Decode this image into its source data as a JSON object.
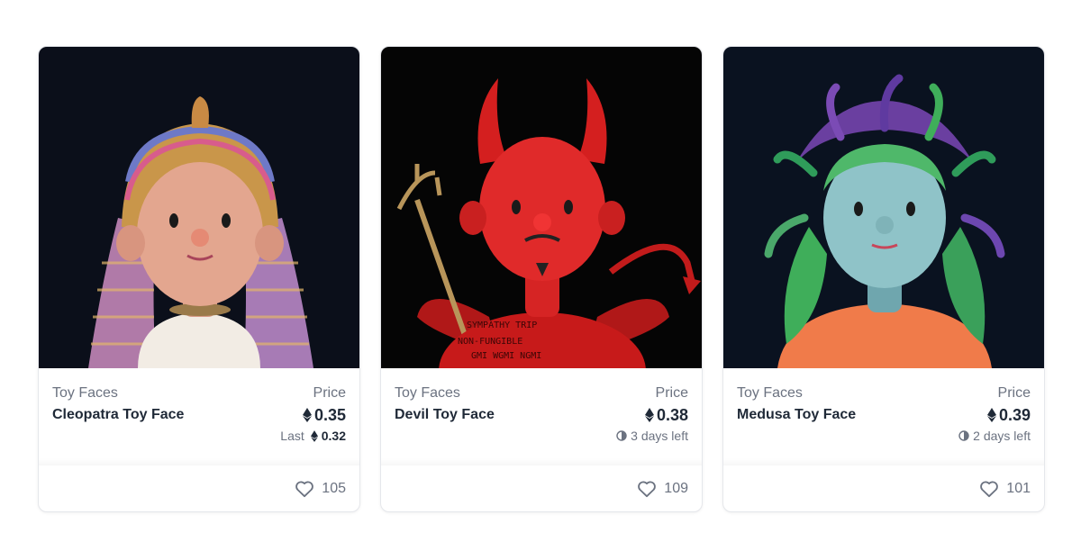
{
  "cards": [
    {
      "collection": "Toy Faces",
      "name": "Cleopatra Toy Face",
      "price_label": "Price",
      "price": "0.35",
      "sub_prefix": "Last",
      "sub_value": "0.32",
      "likes": "105",
      "bg": "#0b0f1a"
    },
    {
      "collection": "Toy Faces",
      "name": "Devil Toy Face",
      "price_label": "Price",
      "price": "0.38",
      "sub_text": "3 days left",
      "likes": "109",
      "bg": "#050505"
    },
    {
      "collection": "Toy Faces",
      "name": "Medusa Toy Face",
      "price_label": "Price",
      "price": "0.39",
      "sub_text": "2 days left",
      "likes": "101",
      "bg": "#0a1220"
    }
  ],
  "icons": {
    "currency": "ethereum-icon",
    "timer": "clock-icon",
    "like": "heart-icon"
  }
}
